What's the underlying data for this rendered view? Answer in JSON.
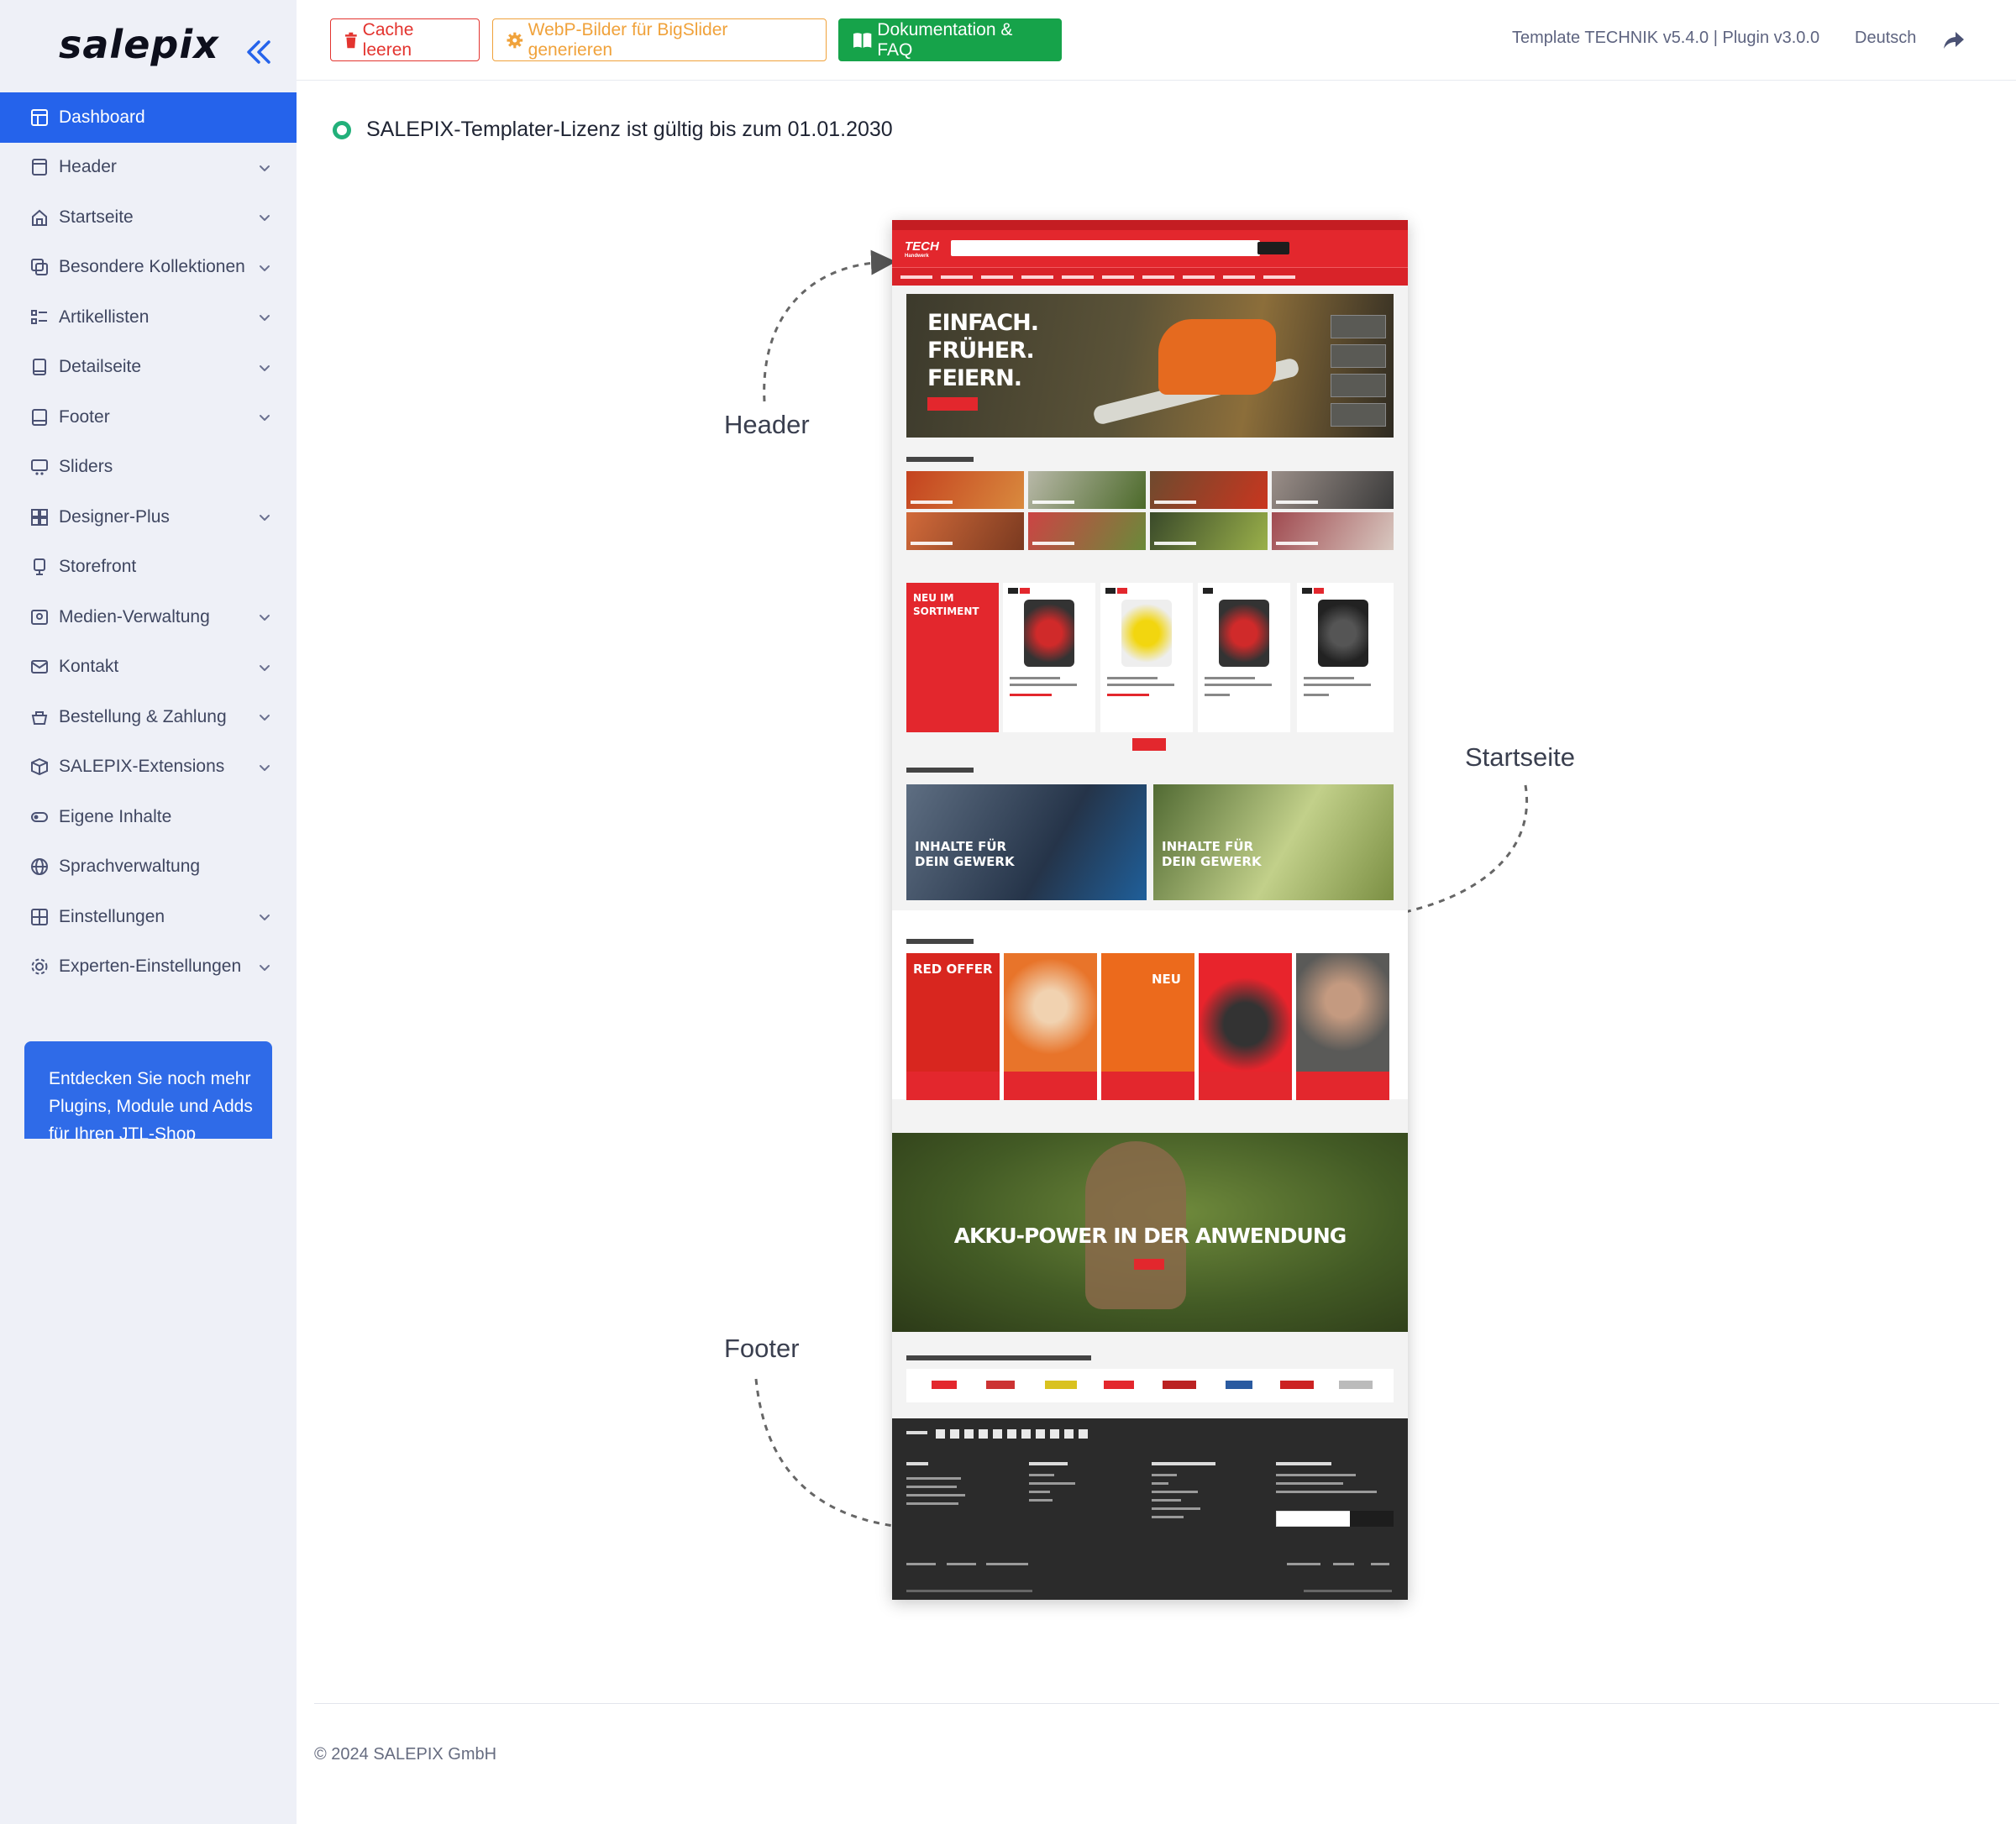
{
  "brand": {
    "logo_text": "salepix"
  },
  "sidebar": {
    "items": [
      {
        "label": "Dashboard",
        "icon": "dashboard-icon",
        "active": true,
        "expandable": false
      },
      {
        "label": "Header",
        "icon": "header-icon",
        "active": false,
        "expandable": true
      },
      {
        "label": "Startseite",
        "icon": "home-icon",
        "active": false,
        "expandable": true
      },
      {
        "label": "Besondere Kollektionen",
        "icon": "collections-icon",
        "active": false,
        "expandable": true
      },
      {
        "label": "Artikellisten",
        "icon": "list-icon",
        "active": false,
        "expandable": true
      },
      {
        "label": "Detailseite",
        "icon": "tablet-icon",
        "active": false,
        "expandable": true
      },
      {
        "label": "Footer",
        "icon": "footer-icon",
        "active": false,
        "expandable": true
      },
      {
        "label": "Sliders",
        "icon": "slider-icon",
        "active": false,
        "expandable": false
      },
      {
        "label": "Designer-Plus",
        "icon": "grid-icon",
        "active": false,
        "expandable": true
      },
      {
        "label": "Storefront",
        "icon": "storefront-icon",
        "active": false,
        "expandable": false
      },
      {
        "label": "Medien-Verwaltung",
        "icon": "image-icon",
        "active": false,
        "expandable": true
      },
      {
        "label": "Kontakt",
        "icon": "mail-icon",
        "active": false,
        "expandable": true
      },
      {
        "label": "Bestellung & Zahlung",
        "icon": "cart-icon",
        "active": false,
        "expandable": true
      },
      {
        "label": "SALEPIX-Extensions",
        "icon": "box-icon",
        "active": false,
        "expandable": true
      },
      {
        "label": "Eigene Inhalte",
        "icon": "toggle-icon",
        "active": false,
        "expandable": false
      },
      {
        "label": "Sprachverwaltung",
        "icon": "globe-icon",
        "active": false,
        "expandable": false
      },
      {
        "label": "Einstellungen",
        "icon": "settings-grid-icon",
        "active": false,
        "expandable": true
      },
      {
        "label": "Experten-Einstellungen",
        "icon": "gear-icon",
        "active": false,
        "expandable": true
      }
    ],
    "promo_text": "Entdecken Sie noch mehr Plugins, Module und Adds für Ihren JTL-Shop"
  },
  "toolbar": {
    "cache_label": "Cache leeren",
    "webp_label": "WebP-Bilder für BigSlider generieren",
    "docs_label": "Dokumentation & FAQ",
    "template_info": "Template TECHNIK v5.4.0 | Plugin v3.0.0",
    "language": "Deutsch"
  },
  "license": {
    "text": "SALEPIX-Templater-Lizenz ist gültig bis zum 01.01.2030",
    "status_color": "#22b07a"
  },
  "callouts": {
    "header": "Header",
    "startseite": "Startseite",
    "footer": "Footer"
  },
  "preview": {
    "brand": "TECH",
    "brand_sub": "Handwerk",
    "hero_text": "EINFACH.\nFRÜHER.\nFEIERN.",
    "new_box": "NEU IM\nSORTIMENT",
    "highlight_1": "INHALTE FÜR\nDEIN GEWERK",
    "highlight_2": "INHALTE FÜR\nDEIN GEWERK",
    "offer_1": "RED OFFER",
    "offer_3": "NEU",
    "akku_text": "AKKU-POWER IN DER ANWENDUNG"
  },
  "colors": {
    "accent": "#2563eb",
    "danger": "#e3342f",
    "warning": "#f0a23b",
    "success": "#16a34a",
    "preview_red": "#e3272d"
  },
  "footer": {
    "copyright": "© 2024 SALEPIX GmbH"
  }
}
